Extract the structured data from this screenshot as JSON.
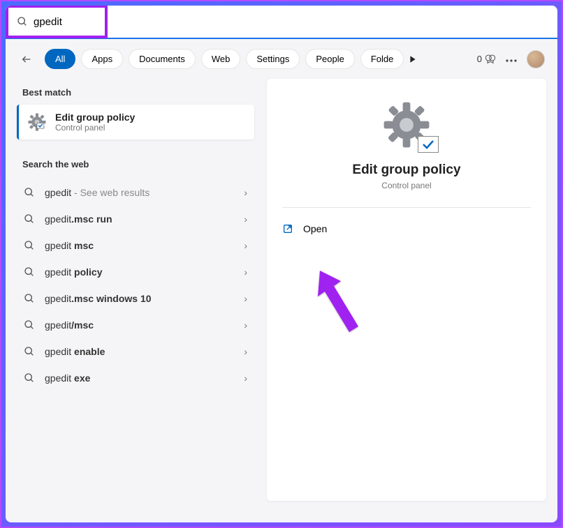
{
  "search": {
    "query": "gpedit",
    "placeholder": ""
  },
  "filters": {
    "active": "All",
    "items": [
      "All",
      "Apps",
      "Documents",
      "Web",
      "Settings",
      "People",
      "Folde"
    ]
  },
  "rewards_count": "0",
  "best_match_header": "Best match",
  "best_match": {
    "title": "Edit group policy",
    "subtitle": "Control panel"
  },
  "web_header": "Search the web",
  "web_results": [
    {
      "prefix": "gpedit",
      "bold": "",
      "suffix": " - See web results"
    },
    {
      "prefix": "gpedit",
      "bold": ".msc run",
      "suffix": ""
    },
    {
      "prefix": "gpedit ",
      "bold": "msc",
      "suffix": ""
    },
    {
      "prefix": "gpedit ",
      "bold": "policy",
      "suffix": ""
    },
    {
      "prefix": "gpedit",
      "bold": ".msc windows 10",
      "suffix": ""
    },
    {
      "prefix": "gpedit",
      "bold": "/msc",
      "suffix": ""
    },
    {
      "prefix": "gpedit ",
      "bold": "enable",
      "suffix": ""
    },
    {
      "prefix": "gpedit ",
      "bold": "exe",
      "suffix": ""
    }
  ],
  "detail": {
    "title": "Edit group policy",
    "subtitle": "Control panel",
    "action": "Open"
  }
}
